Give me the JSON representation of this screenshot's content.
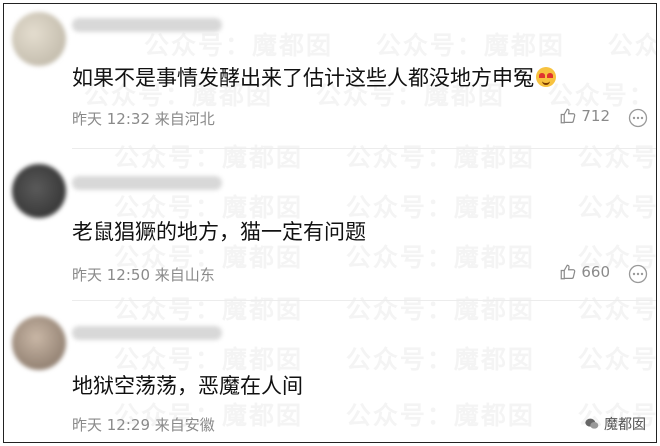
{
  "watermark": "公众号：魔都囡",
  "comments": [
    {
      "text": "如果不是事情发酵出来了估计这些人都没地方申冤",
      "time": "昨天 12:32",
      "location": "来自河北",
      "likes": "712",
      "emoji": "laughing-crying-emoji"
    },
    {
      "text": "老鼠猖獗的地方，猫一定有问题",
      "time": "昨天 12:50",
      "location": "来自山东",
      "likes": "660"
    },
    {
      "text": "地狱空荡荡，恶魔在人间",
      "time": "昨天 12:29",
      "location": "来自安徽",
      "likes": ""
    }
  ],
  "brand": "魔都囡",
  "colors": {
    "text": "#111111",
    "meta": "#8a8a8a",
    "divider": "#ececec",
    "watermark": "rgba(0,0,0,0.045)"
  }
}
